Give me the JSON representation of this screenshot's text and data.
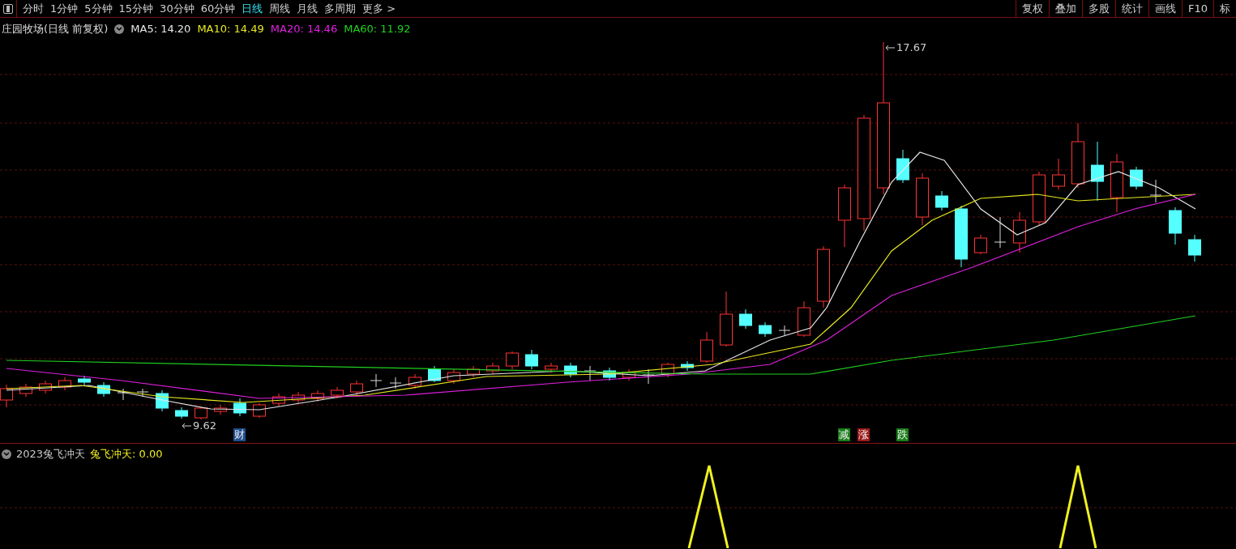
{
  "toolbar": {
    "period_tabs": [
      {
        "label": "分时",
        "selected": false
      },
      {
        "label": "1分钟",
        "selected": false
      },
      {
        "label": "5分钟",
        "selected": false
      },
      {
        "label": "15分钟",
        "selected": false
      },
      {
        "label": "30分钟",
        "selected": false
      },
      {
        "label": "60分钟",
        "selected": false
      },
      {
        "label": "日线",
        "selected": true
      },
      {
        "label": "周线",
        "selected": false
      },
      {
        "label": "月线",
        "selected": false
      },
      {
        "label": "多周期",
        "selected": false
      },
      {
        "label": "更多 >",
        "selected": false
      }
    ],
    "tools": [
      "复权",
      "叠加",
      "多股",
      "统计",
      "画线",
      "F10",
      "标"
    ]
  },
  "chart": {
    "title": "庄园牧场(日线 前复权)",
    "moving_averages": [
      {
        "label": "MA5: 14.20",
        "color": "#e6e6e6"
      },
      {
        "label": "MA10: 14.49",
        "color": "#e8e820"
      },
      {
        "label": "MA20: 14.46",
        "color": "#e020e0"
      },
      {
        "label": "MA60: 11.92",
        "color": "#20d020"
      }
    ],
    "high_label": "17.67",
    "low_label": "9.62",
    "event_markers": [
      {
        "label": "财",
        "color": "#1f4e8c"
      },
      {
        "label": "减",
        "color": "#1a7d1a"
      },
      {
        "label": "涨",
        "color": "#9c1a1a"
      },
      {
        "label": "跌",
        "color": "#1a7d1a"
      }
    ]
  },
  "indicator": {
    "name": "2023兔飞冲天",
    "value": "兔飞冲天: 0.00"
  }
}
